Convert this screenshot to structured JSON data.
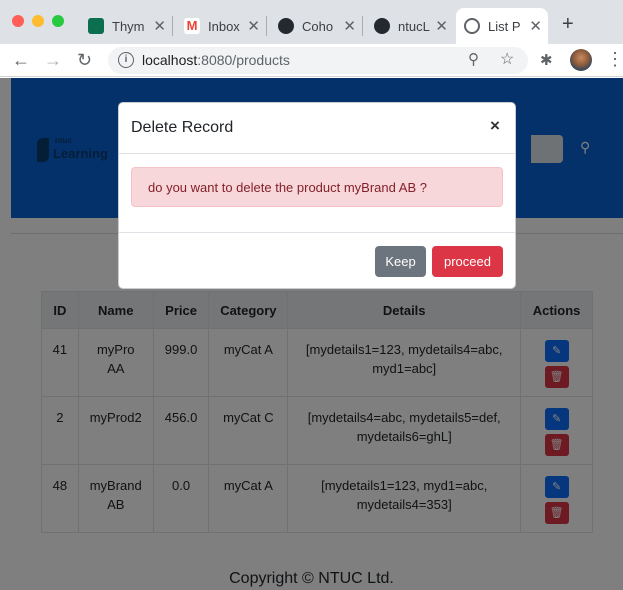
{
  "browser": {
    "tabs": [
      {
        "title": "Thym",
        "favicon_color": "#0b6e4f"
      },
      {
        "title": "Inbox",
        "favicon_color": "#ea4335"
      },
      {
        "title": "Coho",
        "favicon_color": "#24292f"
      },
      {
        "title": "ntucL",
        "favicon_color": "#24292f"
      },
      {
        "title": "List P",
        "favicon_color": "#5f6368"
      }
    ],
    "url_host": "localhost",
    "url_path": ":8080/products"
  },
  "table": {
    "headers": [
      "ID",
      "Name",
      "Price",
      "Category",
      "Details",
      "Actions"
    ],
    "rows": [
      {
        "id": "41",
        "name": "myPro AA",
        "price": "999.0",
        "category": "myCat A",
        "details": "[mydetails1=123, mydetails4=abc, myd1=abc]"
      },
      {
        "id": "2",
        "name": "myProd2",
        "price": "456.0",
        "category": "myCat C",
        "details": "[mydetails4=abc, mydetails5=def, mydetails6=ghL]"
      },
      {
        "id": "48",
        "name": "myBrand AB",
        "price": "0.0",
        "category": "myCat A",
        "details": "[mydetails1=123, myd1=abc, mydetails4=353]"
      }
    ]
  },
  "footer": {
    "text": "Copyright © NTUC Ltd."
  },
  "modal": {
    "title": "Delete Record",
    "close_glyph": "×",
    "message": "do you want to delete the product myBrand AB ?",
    "keep_label": "Keep",
    "proceed_label": "proceed"
  },
  "logo": {
    "small_text": "ntuc",
    "big_text": "Learning"
  },
  "colors": {
    "hero": "#0b63d6",
    "danger": "#dc3545",
    "secondary": "#6c757d",
    "alert_bg": "#f8d7da"
  }
}
